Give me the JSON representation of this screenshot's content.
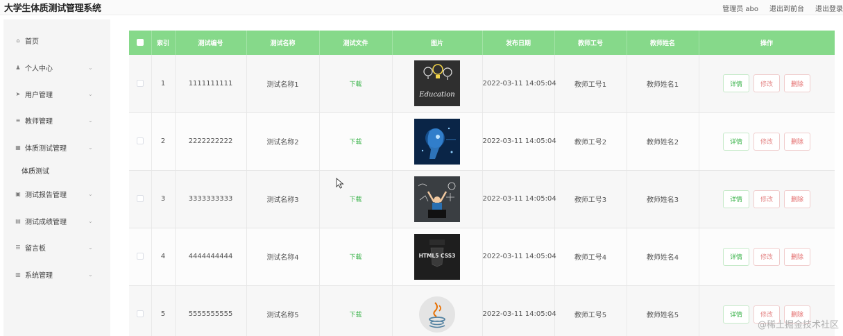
{
  "header": {
    "title": "大学生体质测试管理系统",
    "user_label": "管理员 abo",
    "to_front_label": "退出到前台",
    "logout_label": "退出登录"
  },
  "sidebar": {
    "items": [
      {
        "label": "首页",
        "icon": "home-icon",
        "glyph": "⌂",
        "has_children": false
      },
      {
        "label": "个人中心",
        "icon": "user-icon",
        "glyph": "♟",
        "has_children": true
      },
      {
        "label": "用户管理",
        "icon": "send-icon",
        "glyph": "➤",
        "has_children": true
      },
      {
        "label": "教师管理",
        "icon": "list-icon",
        "glyph": "≡",
        "has_children": true
      },
      {
        "label": "体质测试管理",
        "icon": "grid-icon",
        "glyph": "▦",
        "has_children": true
      },
      {
        "label": "测试报告管理",
        "icon": "report-icon",
        "glyph": "▣",
        "has_children": true
      },
      {
        "label": "测试成绩管理",
        "icon": "score-icon",
        "glyph": "▤",
        "has_children": true
      },
      {
        "label": "留言板",
        "icon": "message-icon",
        "glyph": "☰",
        "has_children": true
      },
      {
        "label": "系统管理",
        "icon": "settings-icon",
        "glyph": "▥",
        "has_children": true
      }
    ],
    "sub_items": [
      {
        "label": "体质测试"
      }
    ]
  },
  "table": {
    "headers": {
      "index": "索引",
      "test_no": "测试编号",
      "test_name": "测试名称",
      "test_file": "测试文件",
      "image": "图片",
      "date": "发布日期",
      "teacher_no": "教师工号",
      "teacher_name": "教师姓名",
      "actions": "操作"
    },
    "rows": [
      {
        "index": "1",
        "test_no": "1111111111",
        "test_name": "测试名称1",
        "file": "下载",
        "image": "education-chalkboard-image",
        "image_text": "Education",
        "date": "2022-03-11 14:05:04",
        "teacher_no": "教师工号1",
        "teacher_name": "教师姓名1"
      },
      {
        "index": "2",
        "test_no": "2222222222",
        "test_name": "测试名称2",
        "file": "下载",
        "image": "ai-head-image",
        "image_text": "",
        "date": "2022-03-11 14:05:04",
        "teacher_no": "教师工号2",
        "teacher_name": "教师姓名2"
      },
      {
        "index": "3",
        "test_no": "3333333333",
        "test_name": "测试名称3",
        "file": "下载",
        "image": "chalkboard-student-image",
        "image_text": "",
        "date": "2022-03-11 14:05:04",
        "teacher_no": "教师工号3",
        "teacher_name": "教师姓名3"
      },
      {
        "index": "4",
        "test_no": "4444444444",
        "test_name": "测试名称4",
        "file": "下载",
        "image": "html5-css3-image",
        "image_text": "HTML5 CSS3",
        "date": "2022-03-11 14:05:04",
        "teacher_no": "教师工号4",
        "teacher_name": "教师姓名4"
      },
      {
        "index": "5",
        "test_no": "5555555555",
        "test_name": "测试名称5",
        "file": "下载",
        "image": "java-logo-image",
        "image_text": "",
        "date": "2022-03-11 14:05:04",
        "teacher_no": "教师工号5",
        "teacher_name": "教师姓名5"
      }
    ],
    "actions": {
      "detail": "详情",
      "edit": "修改",
      "delete": "删除"
    }
  },
  "watermark": "@稀土掘金技术社区",
  "colors": {
    "header_green": "#86d98a",
    "link_green": "#3ab34a",
    "danger": "#e36a6a"
  }
}
